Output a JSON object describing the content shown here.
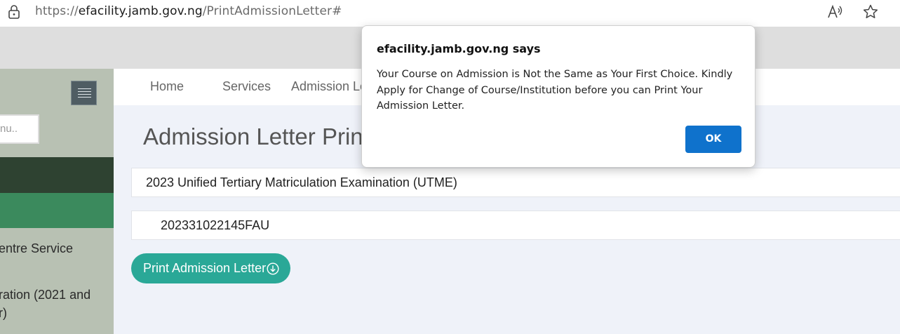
{
  "browser": {
    "url_prefix": "https://",
    "url_domain": "efacility.jamb.gov.ng",
    "url_path": "/PrintAdmissionLetter#",
    "icons": [
      "lock-icon",
      "read-aloud-icon",
      "favorite-star-icon"
    ]
  },
  "sidebar": {
    "search_placeholder": "Search menu..",
    "search_visible_text": "nu..",
    "items": [
      {
        "label": "entre Service"
      },
      {
        "label": "ration (2021 and"
      },
      {
        "label": "r)"
      }
    ]
  },
  "nav": {
    "items": [
      "Home",
      "Services",
      "Admission Le"
    ]
  },
  "main": {
    "title": "Admission Letter Print",
    "exam_value": "2023 Unified Tertiary Matriculation Examination (UTME)",
    "reg_number": "202331022145FAU",
    "print_button_label": "Print Admission Letter"
  },
  "dialog": {
    "title": "efacility.jamb.gov.ng says",
    "message": "Your Course on Admission is Not the Same as Your First Choice. Kindly Apply for Change of Course/Institution before you can Print Your Admission Letter.",
    "ok_label": "OK"
  },
  "colors": {
    "sidebar_bg": "#b8c1b3",
    "sidebar_dark": "#2e4231",
    "sidebar_green": "#3b8a5d",
    "button_teal": "#2aa897",
    "ok_blue": "#0f72cc",
    "content_bg": "#eff2f9"
  }
}
